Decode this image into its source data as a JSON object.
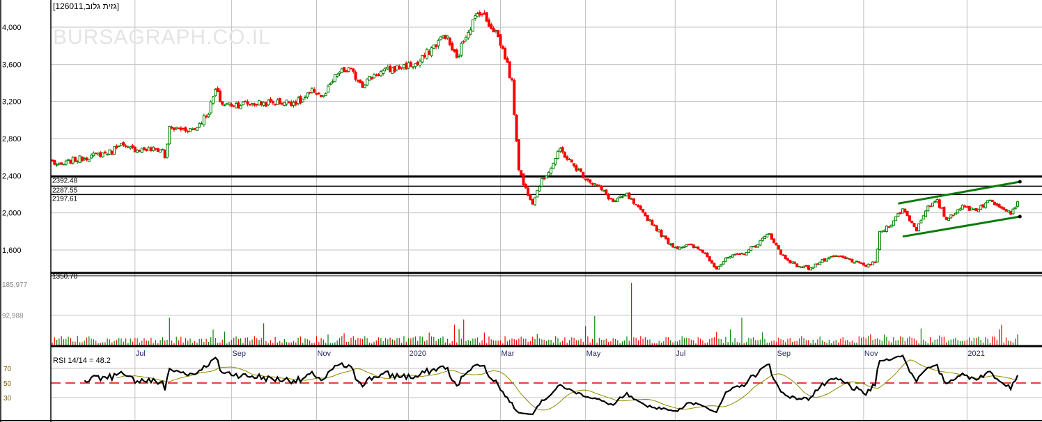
{
  "title": "[גזית גלוב,126011]",
  "watermark": "BURSAGRAPH.CO.IL",
  "colors": {
    "up": "#008000",
    "down": "#ff0000",
    "grid": "#c0c0c0",
    "rsi": "#000000",
    "rsi_signal": "#8b8b00",
    "rsi_mid": "#e00000",
    "channel": "#0a7a0a"
  },
  "chart_data": {
    "type": "candlestick",
    "price_axis": {
      "ticks": [
        1600,
        2000,
        2400,
        2800,
        3200,
        3600,
        4000
      ],
      "tick_labels": [
        "1,600",
        "2,000",
        "2,400",
        "2,800",
        "3,200",
        "3,600",
        "4,000"
      ],
      "range": [
        1350,
        4280
      ]
    },
    "x_ticks": [
      {
        "day": 36,
        "label": "Jul"
      },
      {
        "day": 78,
        "label": "Sep"
      },
      {
        "day": 115,
        "label": "Nov"
      },
      {
        "day": 155,
        "label": "2020"
      },
      {
        "day": 195,
        "label": "Mar"
      },
      {
        "day": 232,
        "label": "May"
      },
      {
        "day": 271,
        "label": "Jul"
      },
      {
        "day": 315,
        "label": "Sep"
      },
      {
        "day": 353,
        "label": "Nov"
      },
      {
        "day": 398,
        "label": "2021"
      }
    ],
    "close_keypoints": [
      [
        0,
        2552
      ],
      [
        3,
        2500
      ],
      [
        8,
        2560
      ],
      [
        26,
        2660
      ],
      [
        29,
        2755
      ],
      [
        32,
        2690
      ],
      [
        48,
        2680
      ],
      [
        49,
        2600
      ],
      [
        51,
        2905
      ],
      [
        62,
        2900
      ],
      [
        68,
        3090
      ],
      [
        71,
        3320
      ],
      [
        74,
        3170
      ],
      [
        80,
        3170
      ],
      [
        108,
        3200
      ],
      [
        114,
        3320
      ],
      [
        118,
        3240
      ],
      [
        124,
        3500
      ],
      [
        129,
        3540
      ],
      [
        135,
        3390
      ],
      [
        141,
        3500
      ],
      [
        153,
        3580
      ],
      [
        159,
        3600
      ],
      [
        165,
        3770
      ],
      [
        171,
        3920
      ],
      [
        176,
        3650
      ],
      [
        180,
        3930
      ],
      [
        186,
        4180
      ],
      [
        189,
        4070
      ],
      [
        193,
        3955
      ],
      [
        197,
        3690
      ],
      [
        200,
        3390
      ],
      [
        202,
        2790
      ],
      [
        203,
        2490
      ],
      [
        205,
        2305
      ],
      [
        209,
        2120
      ],
      [
        212,
        2305
      ],
      [
        217,
        2490
      ],
      [
        221,
        2680
      ],
      [
        226,
        2530
      ],
      [
        232,
        2380
      ],
      [
        238,
        2270
      ],
      [
        244,
        2120
      ],
      [
        250,
        2190
      ],
      [
        255,
        2040
      ],
      [
        261,
        1890
      ],
      [
        267,
        1705
      ],
      [
        271,
        1630
      ],
      [
        277,
        1650
      ],
      [
        283,
        1590
      ],
      [
        289,
        1405
      ],
      [
        294,
        1520
      ],
      [
        300,
        1555
      ],
      [
        306,
        1650
      ],
      [
        312,
        1780
      ],
      [
        317,
        1555
      ],
      [
        323,
        1440
      ],
      [
        329,
        1405
      ],
      [
        335,
        1480
      ],
      [
        341,
        1530
      ],
      [
        347,
        1495
      ],
      [
        353,
        1430
      ],
      [
        358,
        1460
      ],
      [
        360,
        1780
      ],
      [
        365,
        1890
      ],
      [
        370,
        2040
      ],
      [
        376,
        1820
      ],
      [
        380,
        2040
      ],
      [
        385,
        2120
      ],
      [
        389,
        1930
      ],
      [
        395,
        2060
      ],
      [
        402,
        2040
      ],
      [
        408,
        2130
      ],
      [
        414,
        2060
      ],
      [
        417,
        2005
      ],
      [
        420,
        2120
      ]
    ],
    "horizontal_levels": [
      {
        "value": 2392.48,
        "label": "2392.48",
        "weight": "thick"
      },
      {
        "value": 2287.55,
        "label": "2287.55",
        "weight": "thin"
      },
      {
        "value": 2197.61,
        "label": "2197.61",
        "weight": "thin"
      },
      {
        "value": 1350.7,
        "label": "1350.70",
        "weight": "thick"
      }
    ],
    "channel": {
      "upper": [
        [
          368,
          2100
        ],
        [
          421,
          2335
        ]
      ],
      "lower": [
        [
          370,
          1745
        ],
        [
          421,
          1960
        ]
      ]
    },
    "volume": {
      "axis_labels": [
        "185,977",
        "92,988"
      ],
      "axis_values": [
        185977,
        92988
      ],
      "spikes": [
        [
          51,
          85000
        ],
        [
          179,
          80000
        ],
        [
          232,
          60000
        ],
        [
          236,
          90000
        ],
        [
          252,
          190000
        ],
        [
          300,
          85000
        ],
        [
          420,
          35000
        ]
      ]
    },
    "rsi": {
      "label": "RSI 14/14 = 48.2",
      "period": 14,
      "signal": 14,
      "value": 48.2,
      "levels": [
        70,
        50,
        30
      ],
      "level_labels": [
        "70",
        "50",
        "30"
      ]
    }
  }
}
